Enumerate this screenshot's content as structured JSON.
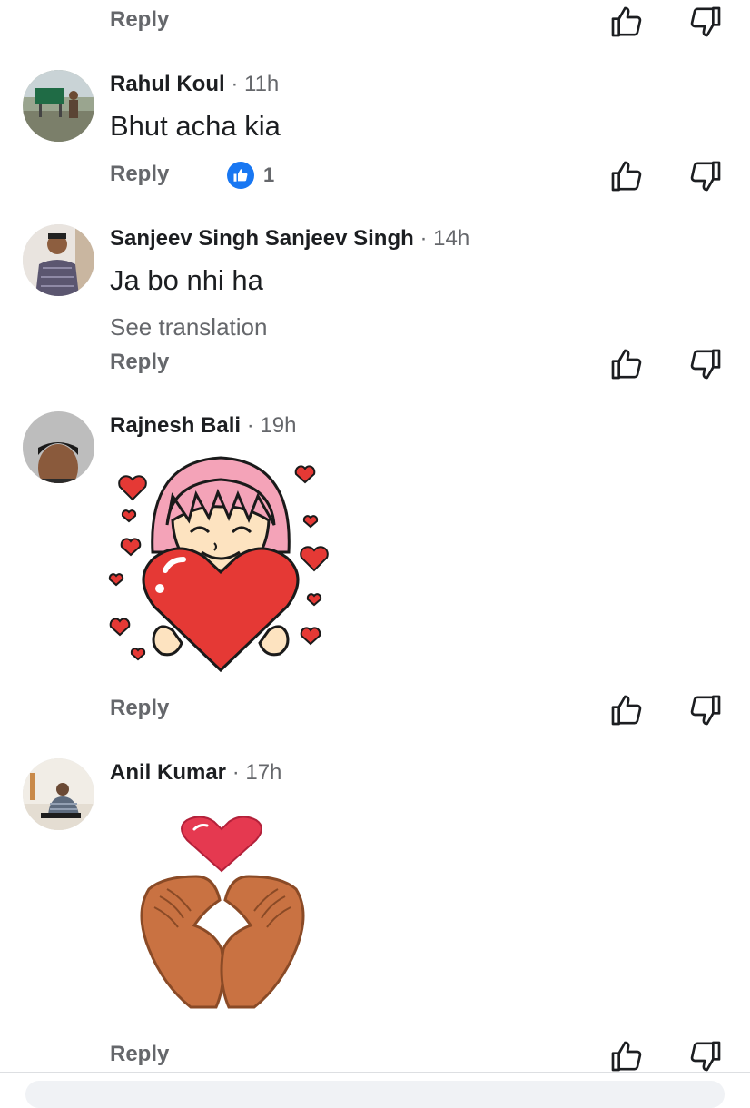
{
  "comments": [
    {
      "reply_label": "Reply"
    },
    {
      "author": "Rahul Koul",
      "time": "11h",
      "text": "Bhut acha kia",
      "reply_label": "Reply",
      "reaction_count": "1"
    },
    {
      "author": "Sanjeev Singh Sanjeev Singh",
      "time": "14h",
      "text": "Ja bo nhi ha",
      "see_translation": "See translation",
      "reply_label": "Reply"
    },
    {
      "author": "Rajnesh Bali",
      "time": "19h",
      "reply_label": "Reply"
    },
    {
      "author": "Anil Kumar",
      "time": "17h",
      "reply_label": "Reply"
    }
  ],
  "separator": "·",
  "colors": {
    "like_blue": "#1877f2",
    "muted_text": "#65676b",
    "heart_red": "#e53935"
  },
  "icons": {
    "like": "thumbs-up-icon",
    "dislike": "thumbs-down-icon"
  }
}
